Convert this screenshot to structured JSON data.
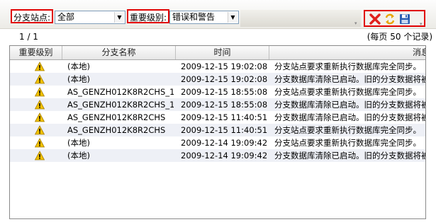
{
  "filters": {
    "branch_label": "分支站点:",
    "branch_value": "全部",
    "severity_label": "重要级别:",
    "severity_value": "错误和警告"
  },
  "toolbar_icons": [
    "delete-x-icon",
    "refresh-icon",
    "save-disk-icon"
  ],
  "pager": {
    "page_count": "1 / 1",
    "per_page": "(每页  50  个记录)"
  },
  "grid": {
    "columns": [
      "重要级别",
      "分支名称",
      "时间",
      "消息"
    ],
    "rows": [
      {
        "branch": "(本地)",
        "time": "2009-12-15 19:02:08",
        "message": "分支站点要求重新执行数据库完全同步。"
      },
      {
        "branch": "(本地)",
        "time": "2009-12-15 19:02:08",
        "message": "分支数据库清除已启动。旧的分支数据将被清除"
      },
      {
        "branch": "AS_GENZH012K8R2CHS_1",
        "time": "2009-12-15 18:55:08",
        "message": "分支站点要求重新执行数据库完全同步。"
      },
      {
        "branch": "AS_GENZH012K8R2CHS_1",
        "time": "2009-12-15 18:55:08",
        "message": "分支数据库清除已启动。旧的分支数据将被清除"
      },
      {
        "branch": "AS_GENZH012K8R2CHS",
        "time": "2009-12-15 11:40:51",
        "message": "分支数据库清除已启动。旧的分支数据将被清除"
      },
      {
        "branch": "AS_GENZH012K8R2CHS",
        "time": "2009-12-15 11:40:51",
        "message": "分支站点要求重新执行数据库完全同步。"
      },
      {
        "branch": "(本地)",
        "time": "2009-12-14 19:09:42",
        "message": "分支站点要求重新执行数据库完全同步。"
      },
      {
        "branch": "(本地)",
        "time": "2009-12-14 19:09:42",
        "message": "分支数据库清除已启动。旧的分支数据将被清除"
      }
    ]
  },
  "colors": {
    "highlight_border": "#e00000",
    "warning_fill": "#f2c200",
    "odd_row": "#eef0f6"
  }
}
